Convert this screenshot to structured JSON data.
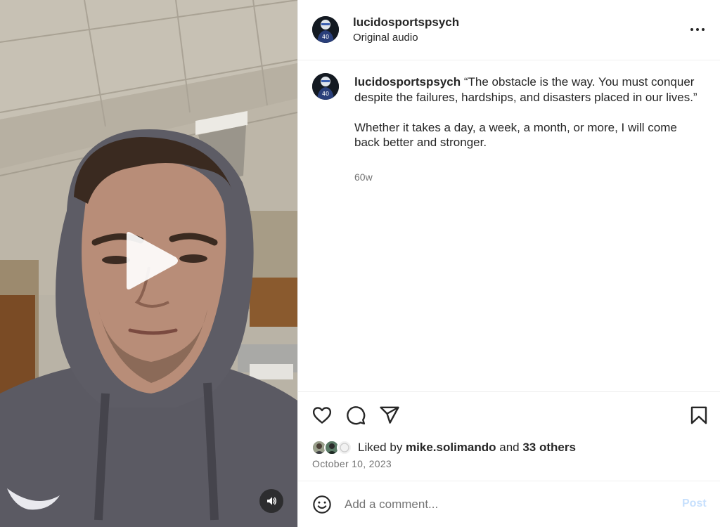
{
  "video": {
    "play_icon": "play-icon",
    "mute_icon": "speaker-icon"
  },
  "header": {
    "username": "lucidosportspsych",
    "audio": "Original audio",
    "more_icon": "more-horizontal-icon"
  },
  "caption": {
    "username": "lucidosportspsych",
    "text": " “The obstacle is the way. You must conquer despite the failures, hardships, and disasters placed in our lives.”\n\nWhether it takes a day, a week, a month, or more, I will come back better and stronger.",
    "age": "60w"
  },
  "actions": {
    "like_icon": "heart-icon",
    "comment_icon": "comment-icon",
    "share_icon": "send-icon",
    "save_icon": "bookmark-icon"
  },
  "likes": {
    "prefix": "Liked by ",
    "user": "mike.solimando",
    "middle": " and ",
    "others": "33 others"
  },
  "post_date": "October 10, 2023",
  "comment": {
    "placeholder": "Add a comment...",
    "post_label": "Post",
    "emoji_icon": "smiley-icon"
  },
  "colors": {
    "text": "#262626",
    "muted": "#737373",
    "post_button": "#c7e0fd",
    "divider": "#efefef"
  }
}
